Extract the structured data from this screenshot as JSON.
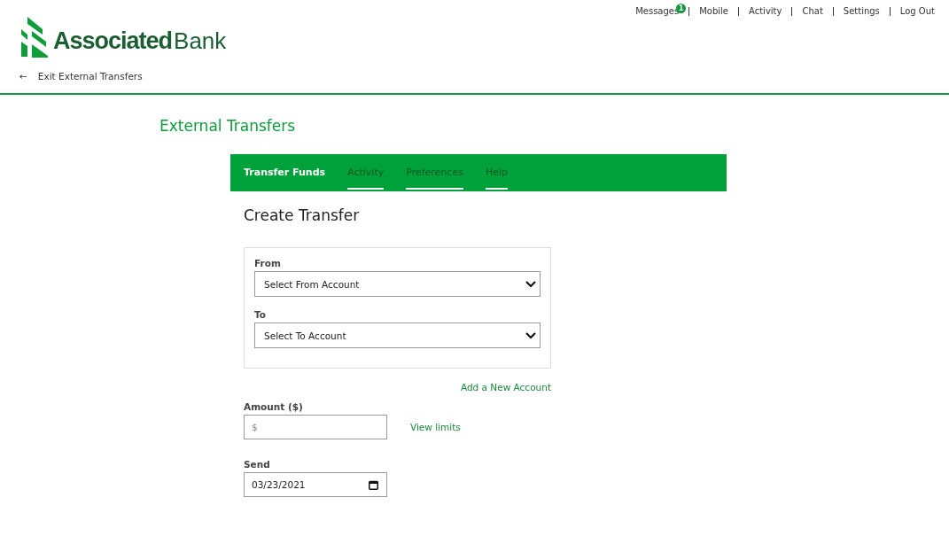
{
  "top_links": [
    {
      "label": "Messages",
      "badge": "1"
    },
    {
      "label": "Mobile"
    },
    {
      "label": "Activity"
    },
    {
      "label": "Chat"
    },
    {
      "label": "Settings"
    },
    {
      "label": "Log Out"
    }
  ],
  "logo": {
    "bold": "Associated",
    "light": "Bank"
  },
  "back_link": {
    "icon": "←",
    "label": "Exit External Transfers"
  },
  "page_title": "External Transfers",
  "tabs": [
    {
      "label": "Transfer Funds",
      "selected": true
    },
    {
      "label": "Activity",
      "selected": false
    },
    {
      "label": "Preferences",
      "selected": false
    },
    {
      "label": "Help",
      "selected": false
    }
  ],
  "heading": "Create Transfer",
  "accounts": [
    {
      "label": "From",
      "value": "Select From Account"
    },
    {
      "label": "To",
      "value": "Select To Account"
    }
  ],
  "add_account_link": "Add a New Account",
  "amount": {
    "label": "Amount ($)",
    "placeholder": "$",
    "link": "View limits"
  },
  "send": {
    "label": "Send",
    "value": "03/23/2021"
  }
}
